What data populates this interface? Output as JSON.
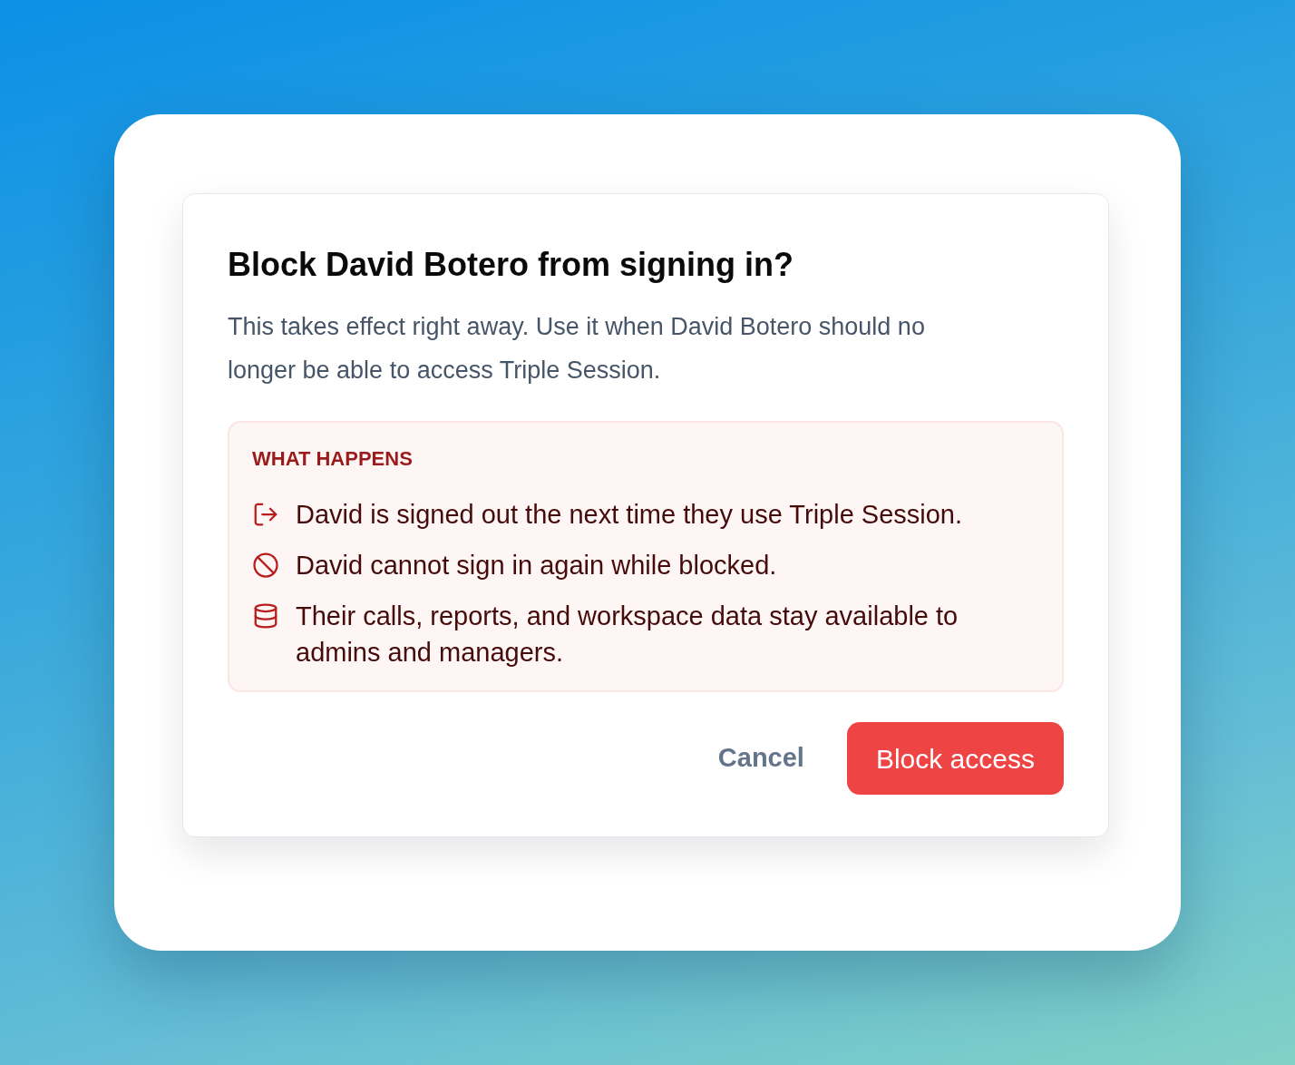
{
  "dialog": {
    "title": "Block David Botero from signing in?",
    "description": "This takes effect right away. Use it when David Botero should no longer be able to access Triple Session.",
    "callout": {
      "heading": "WHAT HAPPENS",
      "items": [
        {
          "kind": "sign-out",
          "text": "David is signed out the next time they use Triple Session."
        },
        {
          "kind": "blocked",
          "text": "David cannot sign in again while blocked."
        },
        {
          "kind": "data",
          "text": "Their calls, reports, and workspace data stay available to admins and managers."
        }
      ]
    },
    "buttons": [
      {
        "kind": "secondary",
        "label": "Cancel"
      },
      {
        "kind": "danger",
        "label": "Block access"
      }
    ]
  }
}
